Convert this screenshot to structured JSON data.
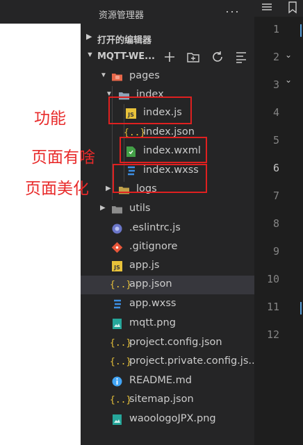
{
  "explorer": {
    "title": "资源管理器",
    "more": "···",
    "open_editors": "打开的编辑器",
    "project": "MQTT-WE..."
  },
  "tree": [
    {
      "name": "pages",
      "type": "folder-open",
      "depth": 1
    },
    {
      "name": "index",
      "type": "folder-open",
      "depth": 2
    },
    {
      "name": "index.js",
      "type": "js",
      "depth": 3
    },
    {
      "name": "index.json",
      "type": "json",
      "depth": 3
    },
    {
      "name": "index.wxml",
      "type": "wxml",
      "depth": 3
    },
    {
      "name": "index.wxss",
      "type": "wxss",
      "depth": 3
    },
    {
      "name": "logs",
      "type": "folder",
      "depth": 2
    },
    {
      "name": "utils",
      "type": "folder",
      "depth": 1
    },
    {
      "name": ".eslintrc.js",
      "type": "eslint",
      "depth": 1
    },
    {
      "name": ".gitignore",
      "type": "git",
      "depth": 1
    },
    {
      "name": "app.js",
      "type": "js",
      "depth": 1
    },
    {
      "name": "app.json",
      "type": "json",
      "depth": 1
    },
    {
      "name": "app.wxss",
      "type": "wxss",
      "depth": 1
    },
    {
      "name": "mqtt.png",
      "type": "image",
      "depth": 1
    },
    {
      "name": "project.config.json",
      "type": "json",
      "depth": 1
    },
    {
      "name": "project.private.config.js...",
      "type": "json",
      "depth": 1
    },
    {
      "name": "README.md",
      "type": "info",
      "depth": 1
    },
    {
      "name": "sitemap.json",
      "type": "json",
      "depth": 1
    },
    {
      "name": "waoologoJPX.png",
      "type": "image",
      "depth": 1
    }
  ],
  "selected": "app.json",
  "line_numbers": [
    "1",
    "2",
    "3",
    "4",
    "5",
    "6",
    "7",
    "8",
    "9",
    "10",
    "11",
    "12"
  ],
  "active_line": "6",
  "annotations": {
    "function": "功能",
    "page_content": "页面有啥",
    "page_style": "页面美化"
  },
  "colors": {
    "annotation": "#e82a2a",
    "sidebar_bg": "#252526",
    "editor_bg": "#1e1e1e",
    "selected_row": "#37373d"
  }
}
